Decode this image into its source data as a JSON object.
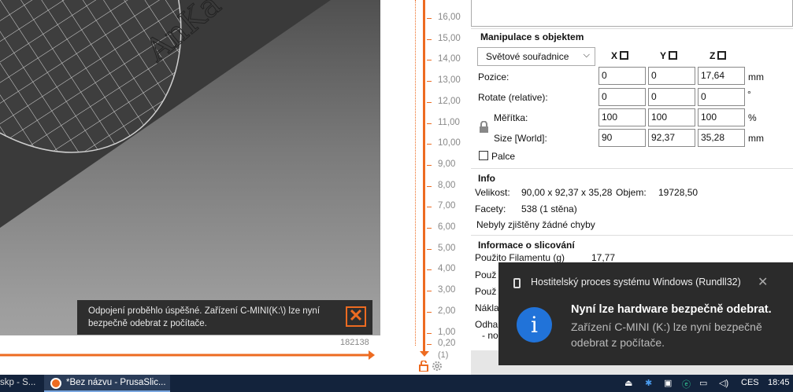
{
  "viewport": {
    "toast_message": "Odpojení proběhlo úspěšné. Zařízení C-MINI(K:\\) lze nyní bezpečně odebrat z počítače.",
    "layer_count": "182138",
    "model_text": "AnKa"
  },
  "layer_slider": {
    "ticks": [
      "16,00",
      "15,00",
      "14,00",
      "13,00",
      "12,00",
      "11,00",
      "10,00",
      "9,00",
      "8,00",
      "7,00",
      "6,00",
      "5,00",
      "4,00",
      "3,00",
      "2,00",
      "1,00",
      "0,20"
    ],
    "bottom_label": "(1)"
  },
  "manipulation": {
    "title": "Manipulace s objektem",
    "coord_system": "Světové souřadnice",
    "axis_x": "X",
    "axis_y": "Y",
    "axis_z": "Z",
    "position_label": "Pozice:",
    "position": [
      "0",
      "0",
      "17,64"
    ],
    "position_unit": "mm",
    "rotate_label": "Rotate (relative):",
    "rotate": [
      "0",
      "0",
      "0"
    ],
    "rotate_unit": "°",
    "scale_label": "Měřítka:",
    "scale": [
      "100",
      "100",
      "100"
    ],
    "scale_unit": "%",
    "size_label": "Size [World]:",
    "size": [
      "90",
      "92,37",
      "35,28"
    ],
    "size_unit": "mm",
    "inches_label": "Palce"
  },
  "info": {
    "title": "Info",
    "size_label": "Velikost:",
    "size_value": "90,00 x 92,37 x 35,28",
    "volume_label": "Objem:",
    "volume_value": "19728,50",
    "facets_label": "Facety:",
    "facets_value": "538 (1 stěna)",
    "errors": "Nebyly zjištěny žádné chyby"
  },
  "slicing_info": {
    "title": "Informace o slicování",
    "filament_label": "Použito Filamentu (g)",
    "filament_value": "17,77",
    "row2": "Použ",
    "row3": "Použ",
    "row4": "Nákla",
    "row5": "Odha",
    "row6": "- no"
  },
  "notification": {
    "app_name": "Hostitelský proces systému Windows (Rundll32)",
    "title": "Nyní lze hardware bezpečně odebrat.",
    "body": "Zařízení C-MINI (K:) lze nyní bezpečně odebrat z počítače.",
    "close": "✕",
    "info_glyph": "i"
  },
  "taskbar": {
    "task1": "skp - S...",
    "task2": "*Bez názvu - PrusaSlic...",
    "language": "CES",
    "time": "18:45"
  },
  "colors": {
    "accent": "#ed6b21",
    "notification_bg": "#2b2b2b",
    "info_blue": "#2173d9",
    "taskbar": "#13233c"
  }
}
